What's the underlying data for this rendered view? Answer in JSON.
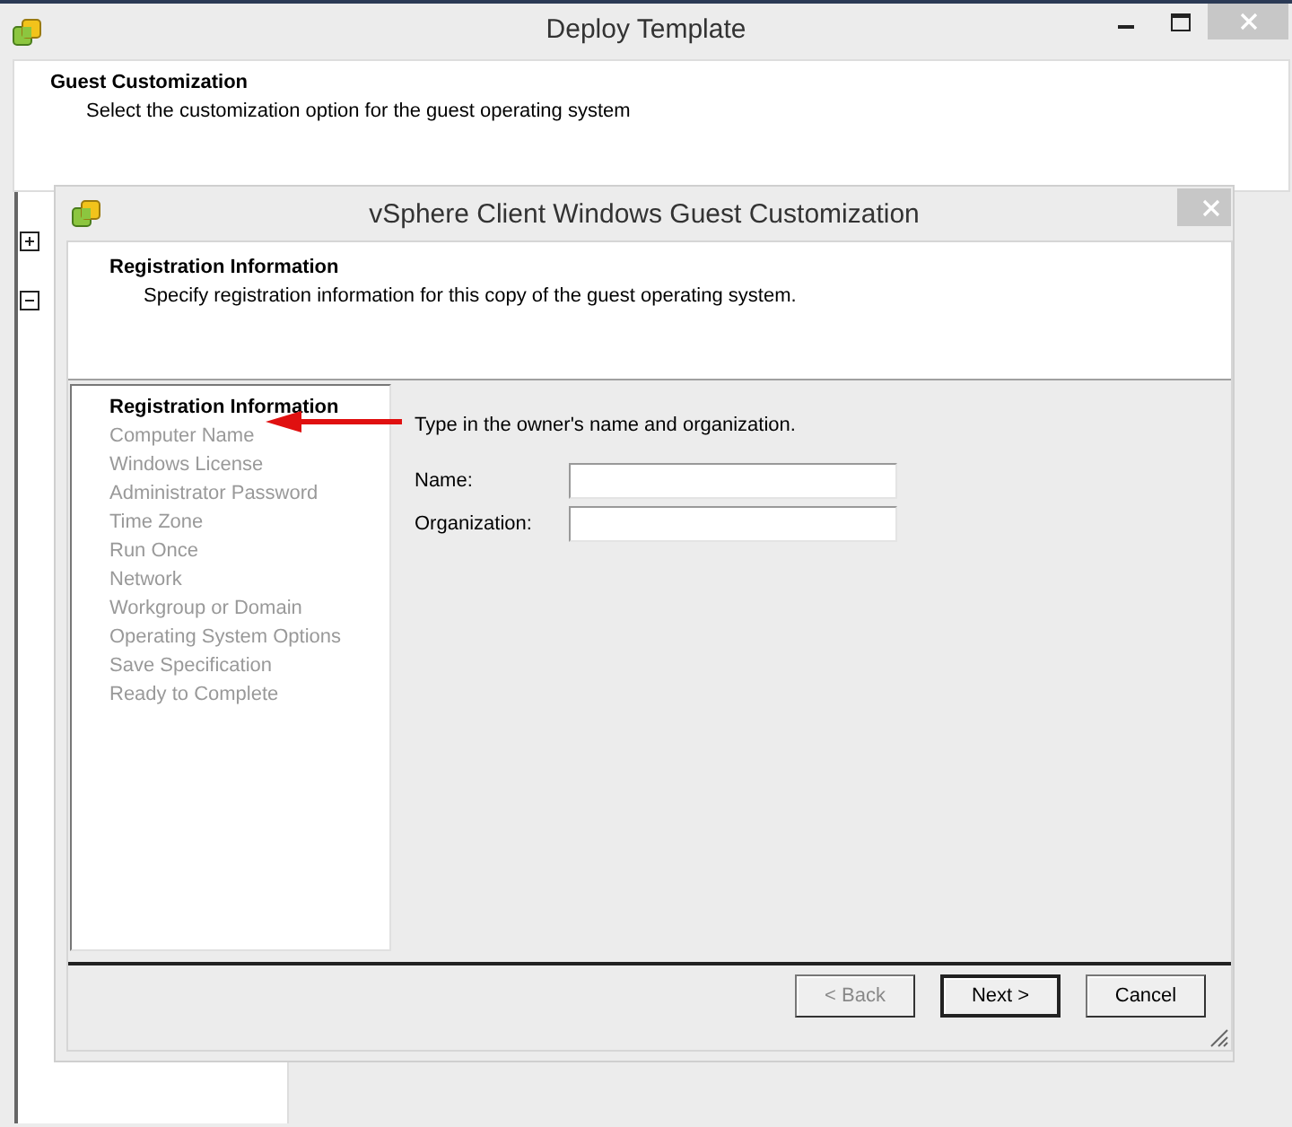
{
  "window": {
    "title": "Deploy Template"
  },
  "header": {
    "title": "Guest Customization",
    "subtitle": "Select the customization option for the guest operating system"
  },
  "tree": [
    {
      "expanded": false
    },
    {
      "expanded": true
    }
  ],
  "dialog": {
    "title": "vSphere Client Windows Guest Customization",
    "header": {
      "title": "Registration Information",
      "subtitle": "Specify registration information for this copy of the guest operating system."
    },
    "steps": [
      {
        "label": "Registration Information",
        "selected": true
      },
      {
        "label": "Computer Name",
        "selected": false
      },
      {
        "label": "Windows License",
        "selected": false
      },
      {
        "label": "Administrator Password",
        "selected": false
      },
      {
        "label": "Time Zone",
        "selected": false
      },
      {
        "label": "Run Once",
        "selected": false
      },
      {
        "label": "Network",
        "selected": false
      },
      {
        "label": "Workgroup or Domain",
        "selected": false
      },
      {
        "label": "Operating System Options",
        "selected": false
      },
      {
        "label": "Save Specification",
        "selected": false
      },
      {
        "label": "Ready to Complete",
        "selected": false
      }
    ],
    "instruction": "Type in the owner's name and organization.",
    "fields": [
      {
        "label": "Name:"
      },
      {
        "label": "Organization:"
      }
    ],
    "buttons": [
      {
        "label": "< Back",
        "disabled": true,
        "default": false
      },
      {
        "label": "Next >",
        "disabled": false,
        "default": true
      },
      {
        "label": "Cancel",
        "disabled": false,
        "default": false
      }
    ]
  }
}
